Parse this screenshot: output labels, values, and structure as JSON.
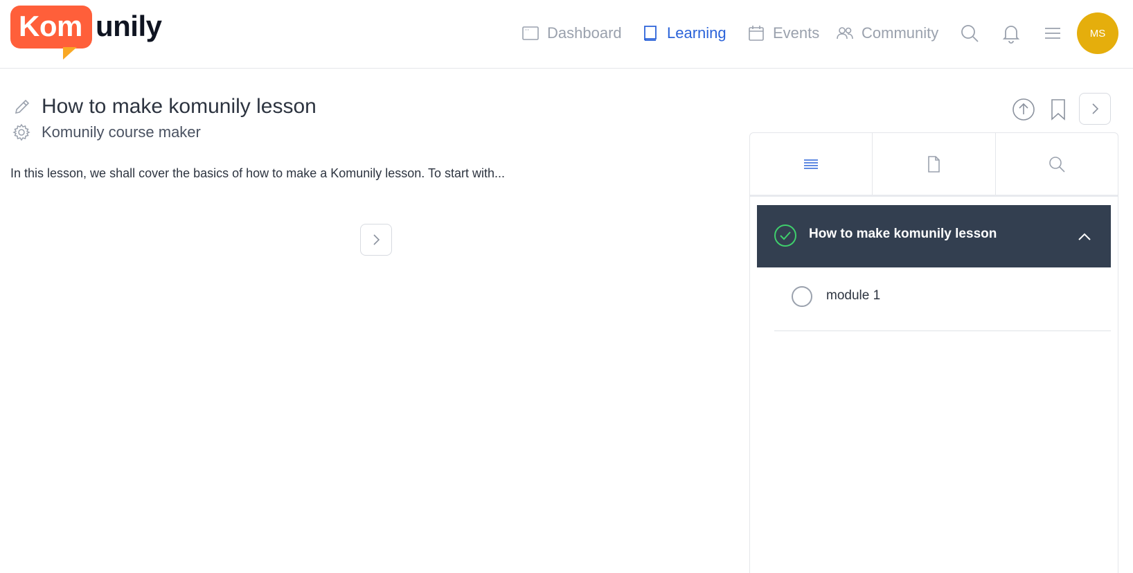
{
  "brand": {
    "logo_part1": "Kom",
    "logo_part2": "unily",
    "color_primary": "#ff5f3a",
    "color_accent": "#f9a825"
  },
  "nav": {
    "items": [
      {
        "label": "Dashboard",
        "icon": "window-icon",
        "active": false
      },
      {
        "label": "Learning",
        "icon": "book-icon",
        "active": true
      },
      {
        "label": "Events",
        "icon": "calendar-icon",
        "active": false
      },
      {
        "label": "Community",
        "icon": "users-icon",
        "active": false
      }
    ],
    "active_color": "#2b63d9"
  },
  "header_tools": [
    "search-icon",
    "bell-icon",
    "menu-icon"
  ],
  "user": {
    "initials": "MS",
    "avatar_color": "#e5ae0c"
  },
  "lesson": {
    "title": "How to make komunily lesson",
    "course": "Komunily course maker",
    "body": "In this lesson, we shall cover the basics of how to make a Komunily lesson. To start with..."
  },
  "lesson_actions": [
    "upload-icon",
    "bookmark-icon",
    "chevron-right-icon"
  ],
  "side_panel": {
    "tabs": [
      {
        "icon": "list-icon",
        "active": true
      },
      {
        "icon": "document-icon",
        "active": false
      },
      {
        "icon": "search-icon",
        "active": false
      }
    ],
    "section": {
      "title": "How to make komunily lesson",
      "completed": true,
      "expanded": true,
      "bg_color": "#333f50",
      "check_color": "#3fcf6c"
    },
    "modules": [
      {
        "label": "module 1",
        "completed": false
      }
    ]
  }
}
